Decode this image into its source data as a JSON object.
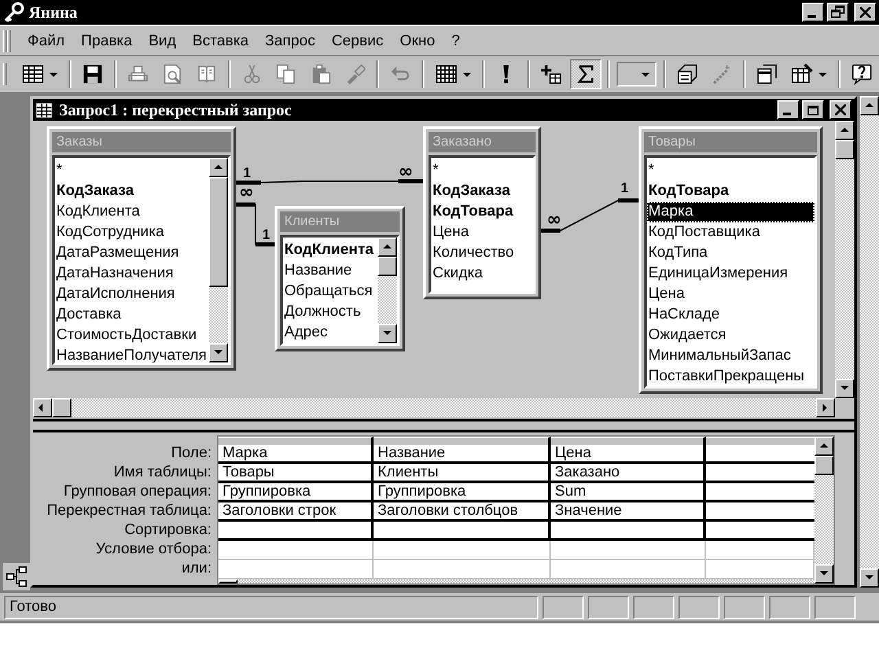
{
  "app_title": "Янина",
  "menu": [
    "Файл",
    "Правка",
    "Вид",
    "Вставка",
    "Запрос",
    "Сервис",
    "Окно",
    "?"
  ],
  "toolbar": [
    {
      "buttons": [
        {
          "kind": "view",
          "disabled": false,
          "pressed": false
        }
      ]
    },
    {
      "buttons": [
        {
          "kind": "save",
          "disabled": false,
          "pressed": false
        }
      ]
    },
    {
      "buttons": [
        {
          "kind": "print",
          "disabled": true,
          "pressed": false
        },
        {
          "kind": "preview",
          "disabled": true,
          "pressed": false
        },
        {
          "kind": "spelling",
          "disabled": true,
          "pressed": false
        }
      ]
    },
    {
      "buttons": [
        {
          "kind": "cut",
          "disabled": true,
          "pressed": false
        },
        {
          "kind": "copy",
          "disabled": true,
          "pressed": false
        },
        {
          "kind": "paste",
          "disabled": true,
          "pressed": false
        },
        {
          "kind": "painter",
          "disabled": true,
          "pressed": false
        }
      ]
    },
    {
      "buttons": [
        {
          "kind": "undo",
          "disabled": true,
          "pressed": false
        }
      ]
    },
    {
      "buttons": [
        {
          "kind": "query-type",
          "disabled": false,
          "pressed": false
        }
      ]
    },
    {
      "buttons": [
        {
          "kind": "run",
          "disabled": false,
          "pressed": false
        }
      ]
    },
    {
      "buttons": [
        {
          "kind": "show-table",
          "disabled": false,
          "pressed": false
        },
        {
          "kind": "totals",
          "disabled": false,
          "pressed": true
        }
      ]
    },
    {
      "buttons": [
        {
          "kind": "combo",
          "disabled": false,
          "pressed": false
        }
      ]
    },
    {
      "buttons": [
        {
          "kind": "properties",
          "disabled": false,
          "pressed": false
        },
        {
          "kind": "build",
          "disabled": true,
          "pressed": false
        }
      ]
    },
    {
      "buttons": [
        {
          "kind": "database-window",
          "disabled": false,
          "pressed": false
        },
        {
          "kind": "new-object",
          "disabled": false,
          "pressed": false
        }
      ]
    },
    {
      "buttons": [
        {
          "kind": "help",
          "disabled": false,
          "pressed": false
        }
      ]
    }
  ],
  "query_window": {
    "title": "Запрос1 : перекрестный запрос",
    "tables": [
      {
        "name": "Заказы",
        "scrollbar": true,
        "fields": [
          {
            "name": "*",
            "key": false,
            "selected": false
          },
          {
            "name": "КодЗаказа",
            "key": true,
            "selected": false
          },
          {
            "name": "КодКлиента",
            "key": false,
            "selected": false
          },
          {
            "name": "КодСотрудника",
            "key": false,
            "selected": false
          },
          {
            "name": "ДатаРазмещения",
            "key": false,
            "selected": false
          },
          {
            "name": "ДатаНазначения",
            "key": false,
            "selected": false
          },
          {
            "name": "ДатаИсполнения",
            "key": false,
            "selected": false
          },
          {
            "name": "Доставка",
            "key": false,
            "selected": false
          },
          {
            "name": "СтоимостьДоставки",
            "key": false,
            "selected": false
          },
          {
            "name": "НазваниеПолучателя",
            "key": false,
            "selected": false
          }
        ]
      },
      {
        "name": "Клиенты",
        "scrollbar": true,
        "fields": [
          {
            "name": "КодКлиента",
            "key": true,
            "selected": false
          },
          {
            "name": "Название",
            "key": false,
            "selected": false
          },
          {
            "name": "Обращаться",
            "key": false,
            "selected": false
          },
          {
            "name": "Должность",
            "key": false,
            "selected": false
          },
          {
            "name": "Адрес",
            "key": false,
            "selected": false
          }
        ]
      },
      {
        "name": "Заказано",
        "scrollbar": false,
        "fields": [
          {
            "name": "*",
            "key": false,
            "selected": false
          },
          {
            "name": "КодЗаказа",
            "key": true,
            "selected": false
          },
          {
            "name": "КодТовара",
            "key": true,
            "selected": false
          },
          {
            "name": "Цена",
            "key": false,
            "selected": false
          },
          {
            "name": "Количество",
            "key": false,
            "selected": false
          },
          {
            "name": "Скидка",
            "key": false,
            "selected": false
          }
        ]
      },
      {
        "name": "Товары",
        "scrollbar": false,
        "fields": [
          {
            "name": "*",
            "key": false,
            "selected": false
          },
          {
            "name": "КодТовара",
            "key": true,
            "selected": false
          },
          {
            "name": "Марка",
            "key": false,
            "selected": true
          },
          {
            "name": "КодПоставщика",
            "key": false,
            "selected": false
          },
          {
            "name": "КодТипа",
            "key": false,
            "selected": false
          },
          {
            "name": "ЕдиницаИзмерения",
            "key": false,
            "selected": false
          },
          {
            "name": "Цена",
            "key": false,
            "selected": false
          },
          {
            "name": "НаСкладе",
            "key": false,
            "selected": false
          },
          {
            "name": "Ожидается",
            "key": false,
            "selected": false
          },
          {
            "name": "МинимальныйЗапас",
            "key": false,
            "selected": false
          },
          {
            "name": "ПоставкиПрекращены",
            "key": false,
            "selected": false
          }
        ]
      }
    ],
    "relations": [
      {
        "one": "1",
        "many": "∞"
      },
      {
        "one": "1",
        "many": "∞"
      },
      {
        "one": "1",
        "many": "∞"
      }
    ],
    "grid": [
      {
        "label": "Поле:",
        "cells": [
          "Марка",
          "Название",
          "Цена"
        ]
      },
      {
        "label": "Имя таблицы:",
        "cells": [
          "Товары",
          "Клиенты",
          "Заказано"
        ]
      },
      {
        "label": "Групповая операция:",
        "cells": [
          "Группировка",
          "Группировка",
          "Sum"
        ]
      },
      {
        "label": "Перекрестная таблица:",
        "cells": [
          "Заголовки строк",
          "Заголовки столбцов",
          "Значение"
        ]
      },
      {
        "label": "Сортировка:"
      },
      {
        "label": "Условие отбора:"
      },
      {
        "label": "или:"
      }
    ]
  },
  "status_bar": {
    "text": "Готово"
  }
}
